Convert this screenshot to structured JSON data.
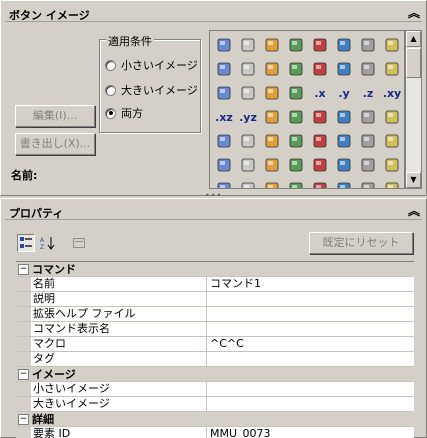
{
  "button_image_panel": {
    "title": "ボタン イメージ",
    "collapse_icon": "double-chevron-up",
    "apply_condition": {
      "legend": "適用条件",
      "options": [
        {
          "label": "小さいイメージ",
          "selected": false
        },
        {
          "label": "大きいイメージ",
          "selected": false
        },
        {
          "label": "両方",
          "selected": true
        }
      ]
    },
    "edit_button": "編集(I)...",
    "export_button": "書き出し(X)...",
    "name_label": "名前:",
    "icons": [
      "cylinder-icon",
      "box-icon",
      "sphere-x-icon",
      "sphere-alt-icon",
      "rounded-box-icon",
      "wedge-icon",
      "copy-box-icon",
      "cube-outline-icon",
      "color-sphere-icon",
      "grid-shapes-icon",
      "cube-group-icon",
      "paint-cube-icon",
      "cube-set-icon",
      "red-x-sphere-icon",
      "blue-sphere-icon",
      "camera-icon",
      "lasso-icon",
      "lasso-alt-icon",
      "lasso-green-icon",
      "link-line-icon",
      "dot-x-label",
      "dot-y-label",
      "dot-z-label",
      "dot-xy-label",
      "dot-xz-label",
      "dot-yz-label",
      "line-icon",
      "line-diagonal-icon",
      "cross-icon",
      "line-x-icon",
      "dashes-icon",
      "target-icon",
      "diamond-orange-icon",
      "double-line-icon",
      "tee-icon",
      "dot-icon",
      "link-icon",
      "pen-line-icon",
      "pen-red-icon",
      "scissors-icon",
      "magnet-icon",
      "page-icon",
      "folder-open-icon",
      "print-icon",
      "save-red-icon",
      "floppy-icon",
      "page-edit-icon",
      "page-copy-icon",
      "cut-icon",
      "copy-icon",
      "paste-icon",
      "undo-icon",
      "redo-icon",
      "zoom-icon",
      "help-icon",
      "grid-icon"
    ],
    "icon_labels": {
      "dot-x-label": ".x",
      "dot-y-label": ".y",
      "dot-z-label": ".z",
      "dot-xy-label": ".xy",
      "dot-xz-label": ".xz",
      "dot-yz-label": ".yz"
    }
  },
  "properties_panel": {
    "title": "プロパティ",
    "collapse_icon": "double-chevron-up",
    "reset_button": "既定にリセット",
    "categories": [
      {
        "name": "コマンド",
        "rows": [
          {
            "key": "名前",
            "value": "コマンド1"
          },
          {
            "key": "説明",
            "value": ""
          },
          {
            "key": "拡張ヘルプ ファイル",
            "value": ""
          },
          {
            "key": "コマンド表示名",
            "value": ""
          },
          {
            "key": "マクロ",
            "value": "^C^C"
          },
          {
            "key": "タグ",
            "value": ""
          }
        ]
      },
      {
        "name": "イメージ",
        "rows": [
          {
            "key": "小さいイメージ",
            "value": ""
          },
          {
            "key": "大きいイメージ",
            "value": ""
          }
        ]
      },
      {
        "name": "詳細",
        "rows": [
          {
            "key": "要素 ID",
            "value": "MMU_0073"
          }
        ]
      }
    ]
  }
}
